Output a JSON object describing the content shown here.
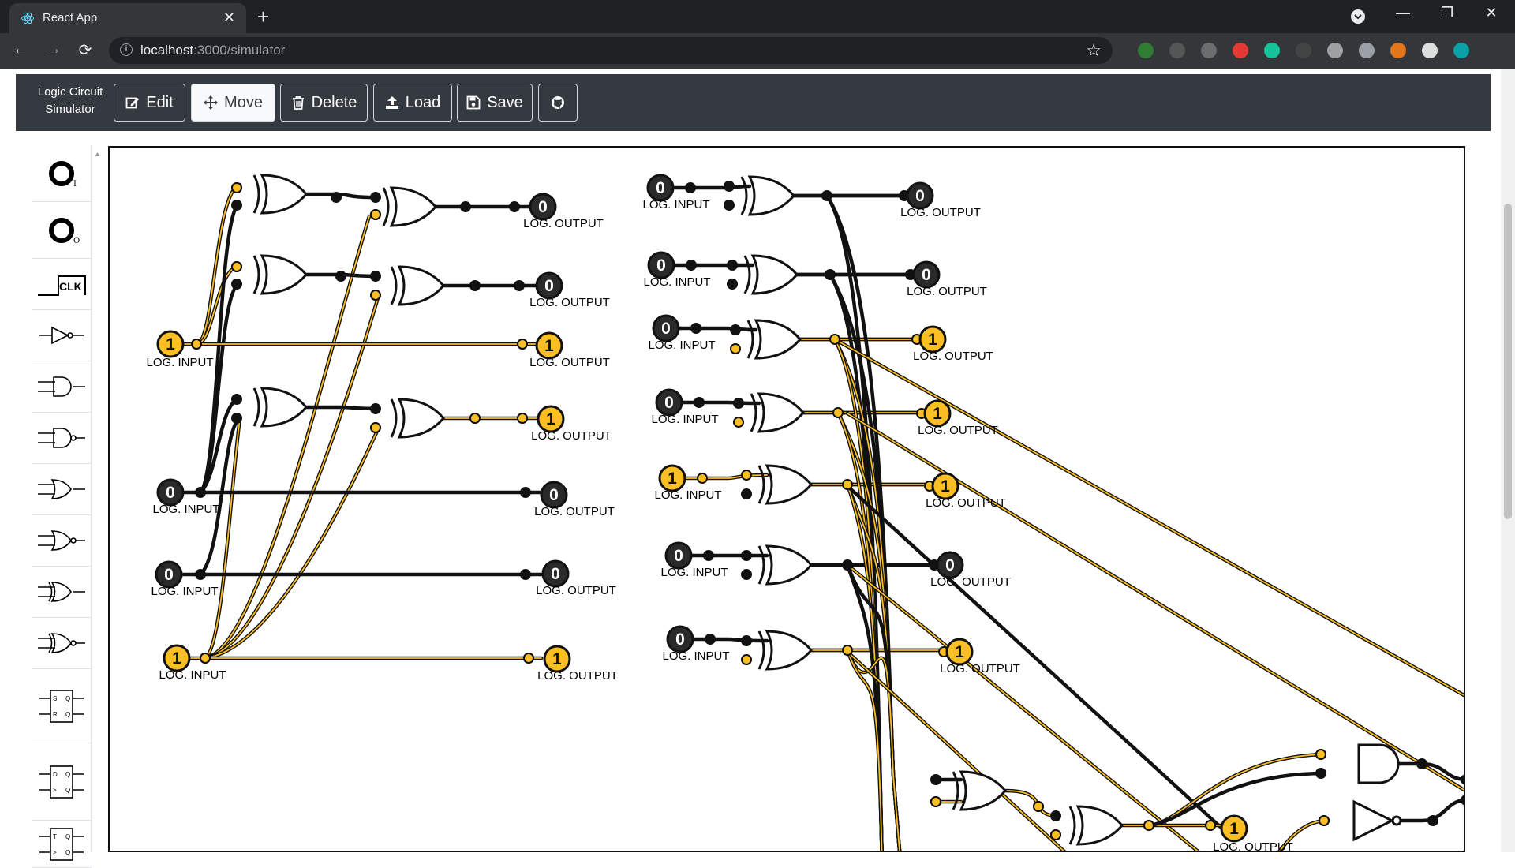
{
  "browser": {
    "tab_title": "React App",
    "tab_close": "✕",
    "new_tab": "+",
    "url_host": "localhost",
    "url_path": ":3000/simulator",
    "info_glyph": "i",
    "star_glyph": "☆",
    "window_controls": [
      "—",
      "❐",
      "✕"
    ],
    "nav": {
      "back": "←",
      "forward": "→",
      "reload": "⟳"
    },
    "extensions": [
      "#2e7d32",
      "#555555",
      "#6d6d6d",
      "#e53935",
      "#15c39a",
      "#444444",
      "#a0a0a0",
      "#9aa0a6",
      "#e2761b",
      "#dddddd",
      "#0aa1a8"
    ]
  },
  "navbar": {
    "brand_line1": "Logic Circuit",
    "brand_line2": "Simulator",
    "buttons": [
      {
        "label": "Edit",
        "icon": "edit-icon",
        "active": false
      },
      {
        "label": "Move",
        "icon": "move-icon",
        "active": true
      },
      {
        "label": "Delete",
        "icon": "trash-icon",
        "active": false
      },
      {
        "label": "Load",
        "icon": "upload-icon",
        "active": false
      },
      {
        "label": "Save",
        "icon": "save-icon",
        "active": false
      },
      {
        "label": "",
        "icon": "github-icon",
        "active": false
      }
    ]
  },
  "sidebar": {
    "items": [
      "logic-input",
      "logic-output",
      "clock",
      "not-gate",
      "and-gate",
      "nand-gate",
      "or-gate",
      "nor-gate",
      "xor-gate",
      "xnor-gate",
      "sr-flip-flop",
      "d-flip-flop",
      "t-flip-flop"
    ],
    "clk_label": "CLK"
  },
  "colors": {
    "on": "#fbbf24",
    "off": "#222222",
    "wire_on": "#fbbf24"
  },
  "circuit": {
    "input_label": "LOG. INPUT",
    "output_label": "LOG. OUTPUT",
    "inputs": [
      {
        "value": "1"
      },
      {
        "value": "0"
      },
      {
        "value": "0"
      },
      {
        "value": "1"
      },
      {
        "value": "0"
      },
      {
        "value": "0"
      },
      {
        "value": "0"
      },
      {
        "value": "0"
      },
      {
        "value": "1"
      },
      {
        "value": "0"
      },
      {
        "value": "0"
      }
    ],
    "outputs": [
      {
        "value": "0"
      },
      {
        "value": "0"
      },
      {
        "value": "1"
      },
      {
        "value": "1"
      },
      {
        "value": "0"
      },
      {
        "value": "0"
      },
      {
        "value": "1"
      },
      {
        "value": "0"
      },
      {
        "value": "0"
      },
      {
        "value": "1"
      },
      {
        "value": "1"
      },
      {
        "value": "1"
      },
      {
        "value": "0"
      },
      {
        "value": "1"
      },
      {
        "value": "1"
      }
    ]
  }
}
